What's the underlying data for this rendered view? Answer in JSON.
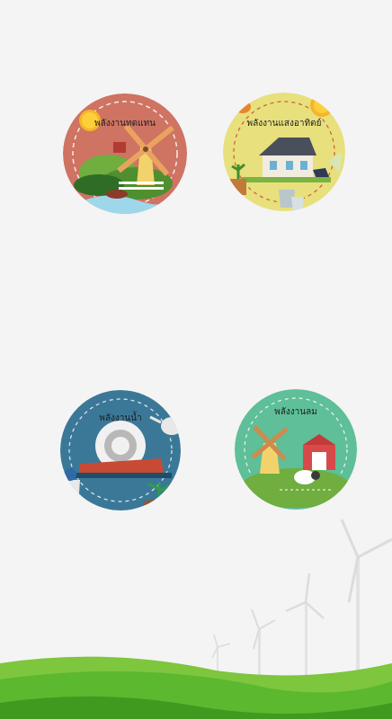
{
  "badges": {
    "alternative": {
      "title": "พลังงานทดแทน",
      "color": "#cf7363"
    },
    "solar": {
      "title": "พลังงานแสงอาทิตย์",
      "color": "#e7e07d"
    },
    "water": {
      "title": "พลังงานน้ำ",
      "color": "#3b7898"
    },
    "wind": {
      "title": "พลังงานลม",
      "color": "#5ebf98"
    }
  },
  "icons": [
    "sun-icon",
    "windmill-icon",
    "house-icon",
    "solar-panel-icon",
    "watering-can-icon",
    "bucket-icon",
    "water-wheel-icon",
    "barn-icon",
    "sheep-icon",
    "pumpkin-icon",
    "plant-icon",
    "wind-turbine-icon"
  ],
  "colors": {
    "background": "#f4f4f4",
    "hill": "#5cb82e",
    "hill_dark": "#3f9a1f"
  }
}
